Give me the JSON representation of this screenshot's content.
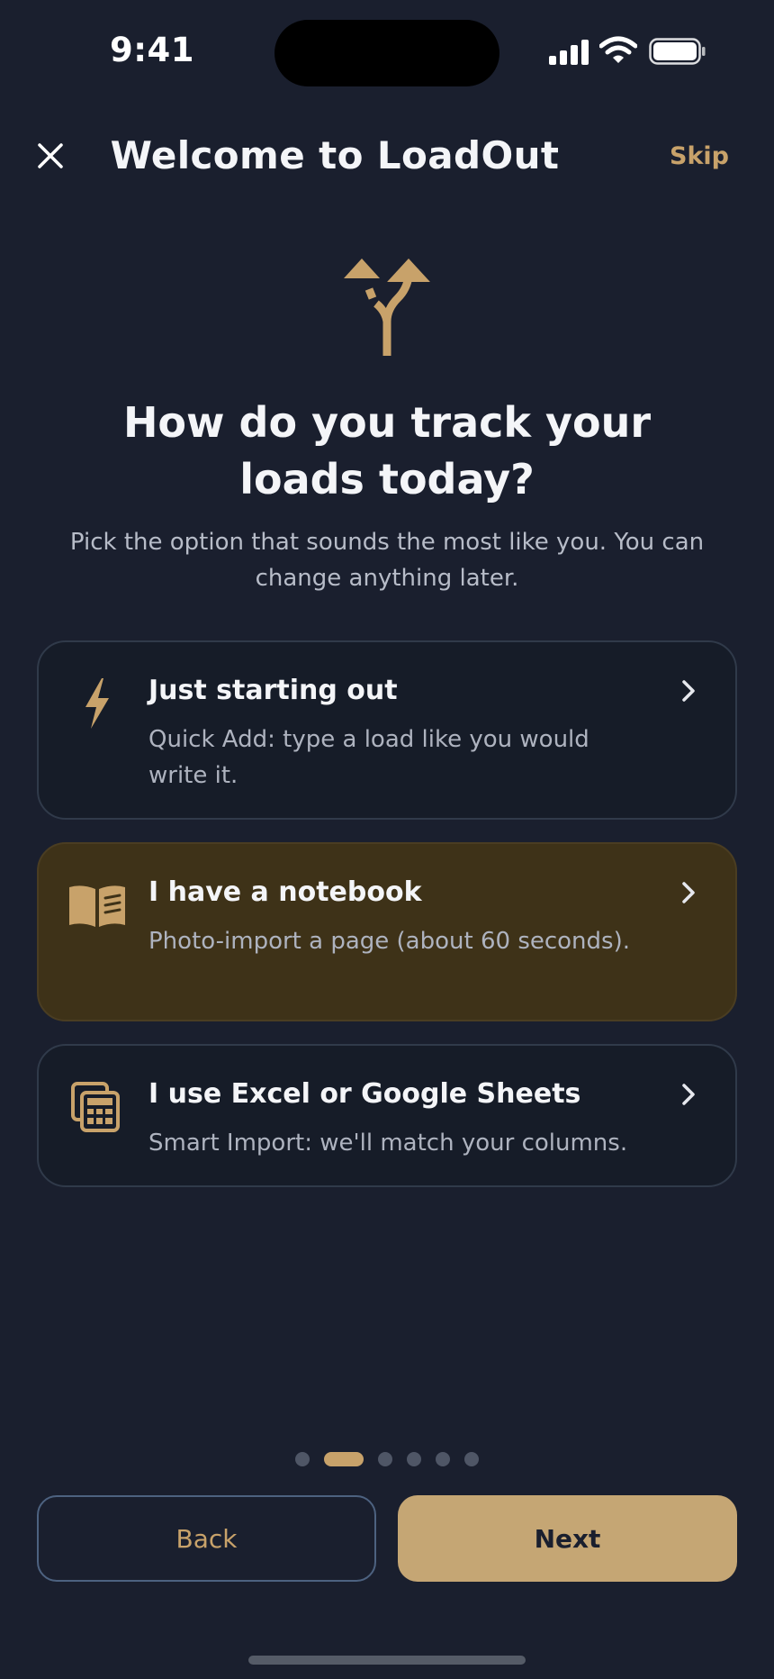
{
  "status_bar": {
    "time": "9:41"
  },
  "header": {
    "title": "Welcome to LoadOut",
    "skip_label": "Skip"
  },
  "hero": {
    "icon": "fork-arrows-icon",
    "question": "How do you track your loads today?",
    "subtitle": "Pick the option that sounds the most like you. You can change anything later."
  },
  "options": [
    {
      "icon": "lightning-icon",
      "title": "Just starting out",
      "description": "Quick Add: type a load like you would write it.",
      "selected": false
    },
    {
      "icon": "open-book-icon",
      "title": "I have a notebook",
      "description": "Photo-import a page (about 60 seconds).",
      "selected": true
    },
    {
      "icon": "spreadsheet-stack-icon",
      "title": "I use Excel or Google Sheets",
      "description": "Smart Import: we'll match your columns.",
      "selected": false
    }
  ],
  "pagination": {
    "total": 6,
    "current": 2
  },
  "footer": {
    "back_label": "Back",
    "next_label": "Next"
  },
  "colors": {
    "background": "#1a1f2e",
    "accent": "#c8a26a",
    "selected_card": "#3e3218"
  }
}
